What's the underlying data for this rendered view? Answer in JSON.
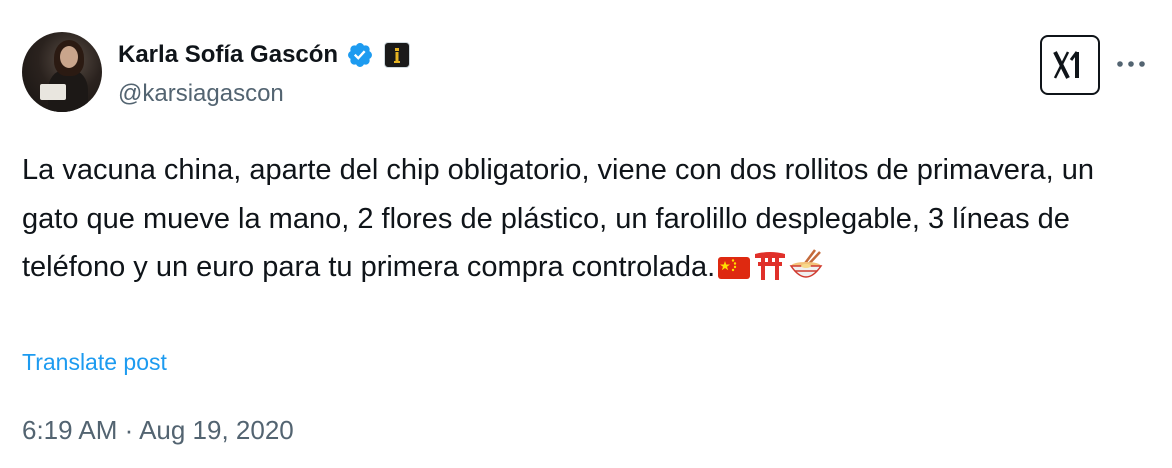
{
  "author": {
    "display_name": "Karla Sofía Gascón",
    "handle": "@karsiagascon",
    "verified_icon": "verified-badge-icon",
    "affiliate_icon": "affiliate-badge-icon"
  },
  "header": {
    "x_logo_icon": "x-logo-icon",
    "more_icon": "more-options-icon"
  },
  "post": {
    "text": "La vacuna china, aparte del chip obligatorio, viene con dos rollitos de primavera, un gato que mueve la mano, 2 flores de plástico, un farolillo desplegable, 3 líneas de teléfono y un euro para tu primera compra controlada.",
    "emojis": [
      "china-flag-emoji",
      "torii-gate-emoji",
      "ramen-bowl-emoji"
    ],
    "translate_label": "Translate post",
    "timestamp": "6:19 AM · Aug 19, 2020"
  },
  "colors": {
    "text": "#0f1419",
    "secondary": "#536471",
    "link": "#1d9bf0",
    "verified": "#1d9bf0"
  }
}
